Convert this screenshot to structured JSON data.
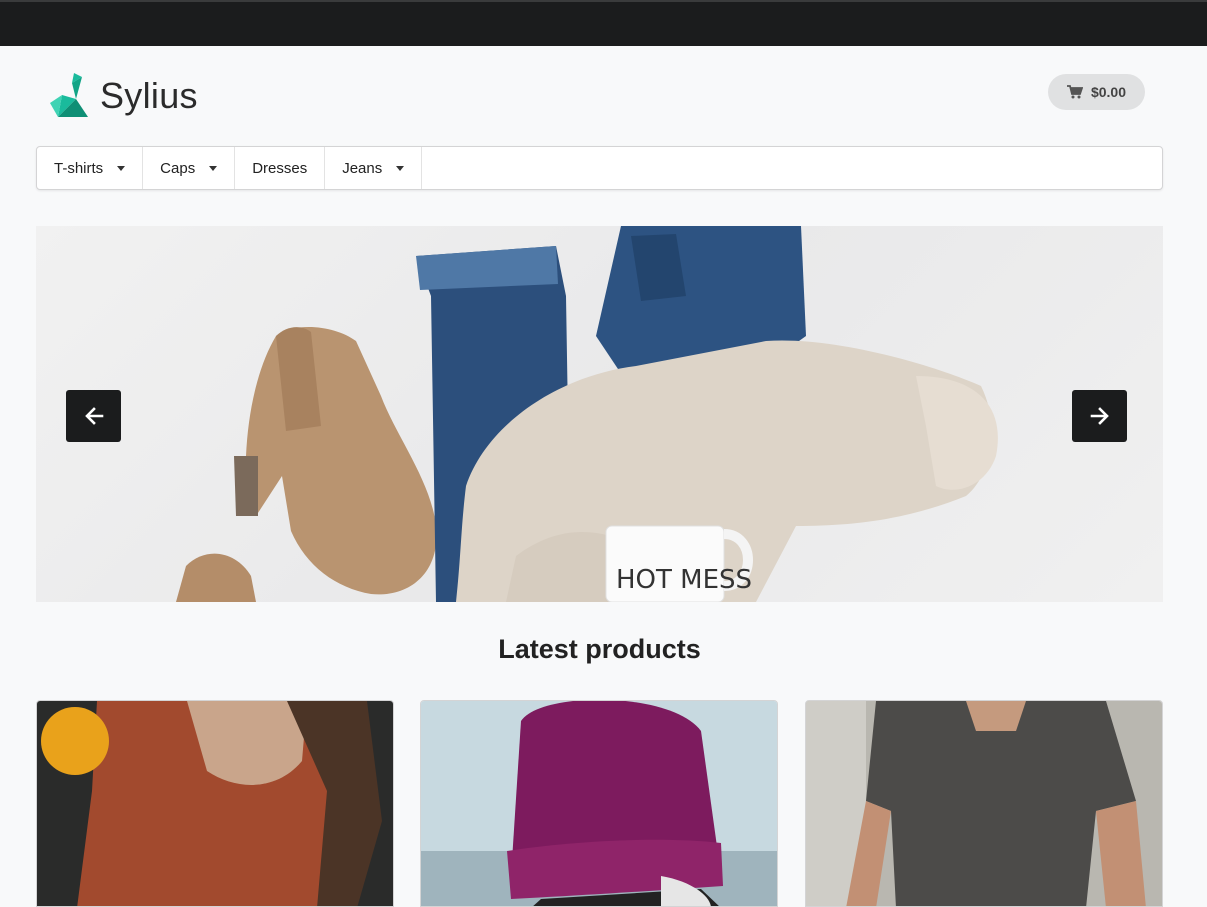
{
  "brand": {
    "name": "Sylius"
  },
  "cart": {
    "total": "$0.00"
  },
  "menu": {
    "items": [
      {
        "label": "T-shirts",
        "dropdown": true
      },
      {
        "label": "Caps",
        "dropdown": true
      },
      {
        "label": "Dresses",
        "dropdown": false
      },
      {
        "label": "Jeans",
        "dropdown": true
      }
    ]
  },
  "hero": {
    "mug_text": "HOT MESS"
  },
  "latest": {
    "title": "Latest products"
  },
  "colors": {
    "accent": "#1abb9c",
    "dark": "#1b1c1d"
  }
}
